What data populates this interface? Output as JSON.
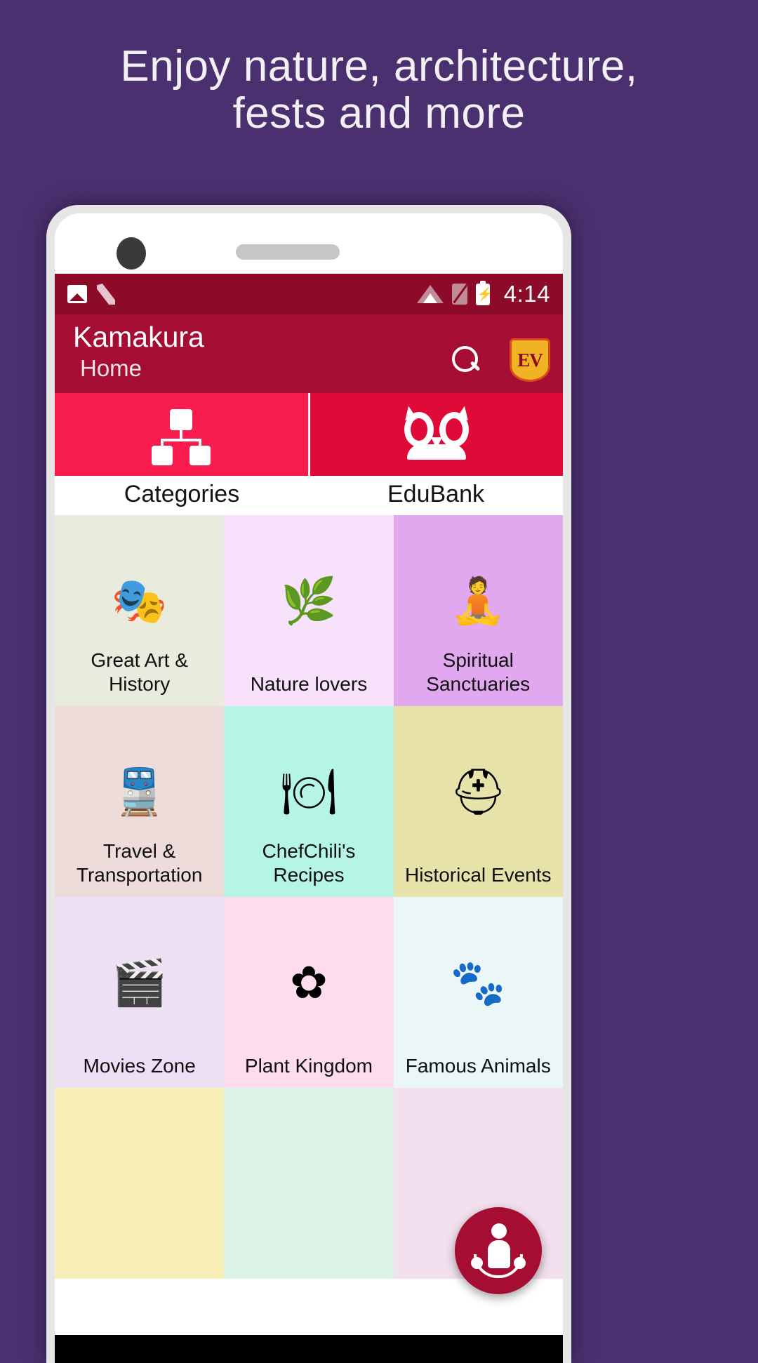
{
  "promo": {
    "line1": "Enjoy nature, architecture,",
    "line2": "fests and more"
  },
  "colors": {
    "page_background": "#4b3070",
    "status_bar": "#8c0b28",
    "app_bar": "#a60d32",
    "tab_active": "#f71b4e",
    "tab_inactive": "#e00a38",
    "fab": "#a60d32"
  },
  "status_bar": {
    "time": "4:14",
    "icons_left": [
      "photo-icon",
      "nova-launcher-icon"
    ],
    "icons_right": [
      "wifi-icon",
      "sim-off-icon",
      "battery-charging-icon"
    ]
  },
  "app_bar": {
    "title": "Kamakura",
    "subtitle": "Home",
    "search_label": "search-icon",
    "logo_text": "EV"
  },
  "tabs": [
    {
      "label": "Categories",
      "icon": "sitemap-icon",
      "active": true
    },
    {
      "label": "EduBank",
      "icon": "owl-icon",
      "active": false
    }
  ],
  "grid": [
    {
      "label": "Great Art & History",
      "icon": "theater-masks-palette-icon",
      "glyph": "🎭",
      "bg": "#e9ebdd"
    },
    {
      "label": "Nature lovers",
      "icon": "leaf-icon",
      "glyph": "🌿",
      "bg": "#f7e1fb"
    },
    {
      "label": "Spiritual Sanctuaries",
      "icon": "buddha-icon",
      "glyph": "🧘",
      "bg": "#e2a8ef"
    },
    {
      "label": "Travel & Transportation",
      "icon": "train-icon",
      "glyph": "🚆",
      "bg": "#eedcdb"
    },
    {
      "label": "ChefChili's Recipes",
      "icon": "food-cloche-icon",
      "glyph": "🍽",
      "bg": "#b4f5e6"
    },
    {
      "label": "Historical Events",
      "icon": "spartan-helmet-icon",
      "glyph": "⛑",
      "bg": "#e7e2a9"
    },
    {
      "label": "Movies Zone",
      "icon": "clapperboard-icon",
      "glyph": "🎬",
      "bg": "#eddff4"
    },
    {
      "label": "Plant Kingdom",
      "icon": "flower-icon",
      "glyph": "✿",
      "bg": "#fcdced"
    },
    {
      "label": "Famous Animals",
      "icon": "paw-print-icon",
      "glyph": "🐾",
      "bg": "#eaf7f6"
    },
    {
      "label": "",
      "icon": "tile-icon",
      "glyph": "",
      "bg": "#f7eeb8"
    },
    {
      "label": "",
      "icon": "tile-icon",
      "glyph": "",
      "bg": "#dcf4e8"
    },
    {
      "label": "",
      "icon": "tile-icon",
      "glyph": "",
      "bg": "#f2e0ee"
    }
  ],
  "fab": {
    "label": "people-nearby-icon"
  }
}
